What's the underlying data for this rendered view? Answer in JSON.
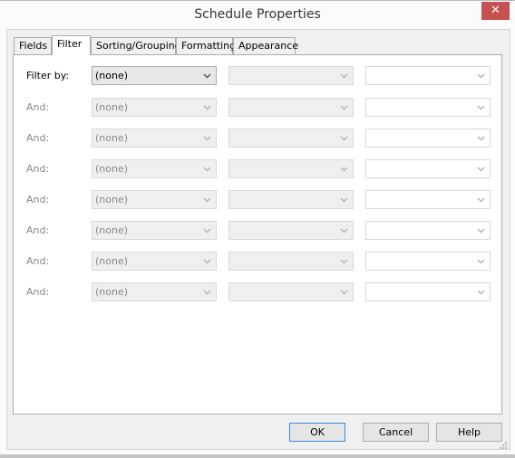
{
  "window": {
    "title": "Schedule Properties",
    "close_icon": "close-icon",
    "close_glyph": "✕"
  },
  "tabs": [
    {
      "label": "Fields",
      "active": false
    },
    {
      "label": "Filter",
      "active": true
    },
    {
      "label": "Sorting/Grouping",
      "active": false
    },
    {
      "label": "Formatting",
      "active": false
    },
    {
      "label": "Appearance",
      "active": false
    }
  ],
  "filter_rows": [
    {
      "label": "Filter by:",
      "field": "(none)",
      "condition": "",
      "value": "",
      "enabled": true
    },
    {
      "label": "And:",
      "field": "(none)",
      "condition": "",
      "value": "",
      "enabled": false
    },
    {
      "label": "And:",
      "field": "(none)",
      "condition": "",
      "value": "",
      "enabled": false
    },
    {
      "label": "And:",
      "field": "(none)",
      "condition": "",
      "value": "",
      "enabled": false
    },
    {
      "label": "And:",
      "field": "(none)",
      "condition": "",
      "value": "",
      "enabled": false
    },
    {
      "label": "And:",
      "field": "(none)",
      "condition": "",
      "value": "",
      "enabled": false
    },
    {
      "label": "And:",
      "field": "(none)",
      "condition": "",
      "value": "",
      "enabled": false
    },
    {
      "label": "And:",
      "field": "(none)",
      "condition": "",
      "value": "",
      "enabled": false
    }
  ],
  "buttons": {
    "ok": "OK",
    "cancel": "Cancel",
    "help": "Help"
  },
  "colors": {
    "close_bg": "#c75050",
    "default_button_border": "#3c8fd9"
  }
}
